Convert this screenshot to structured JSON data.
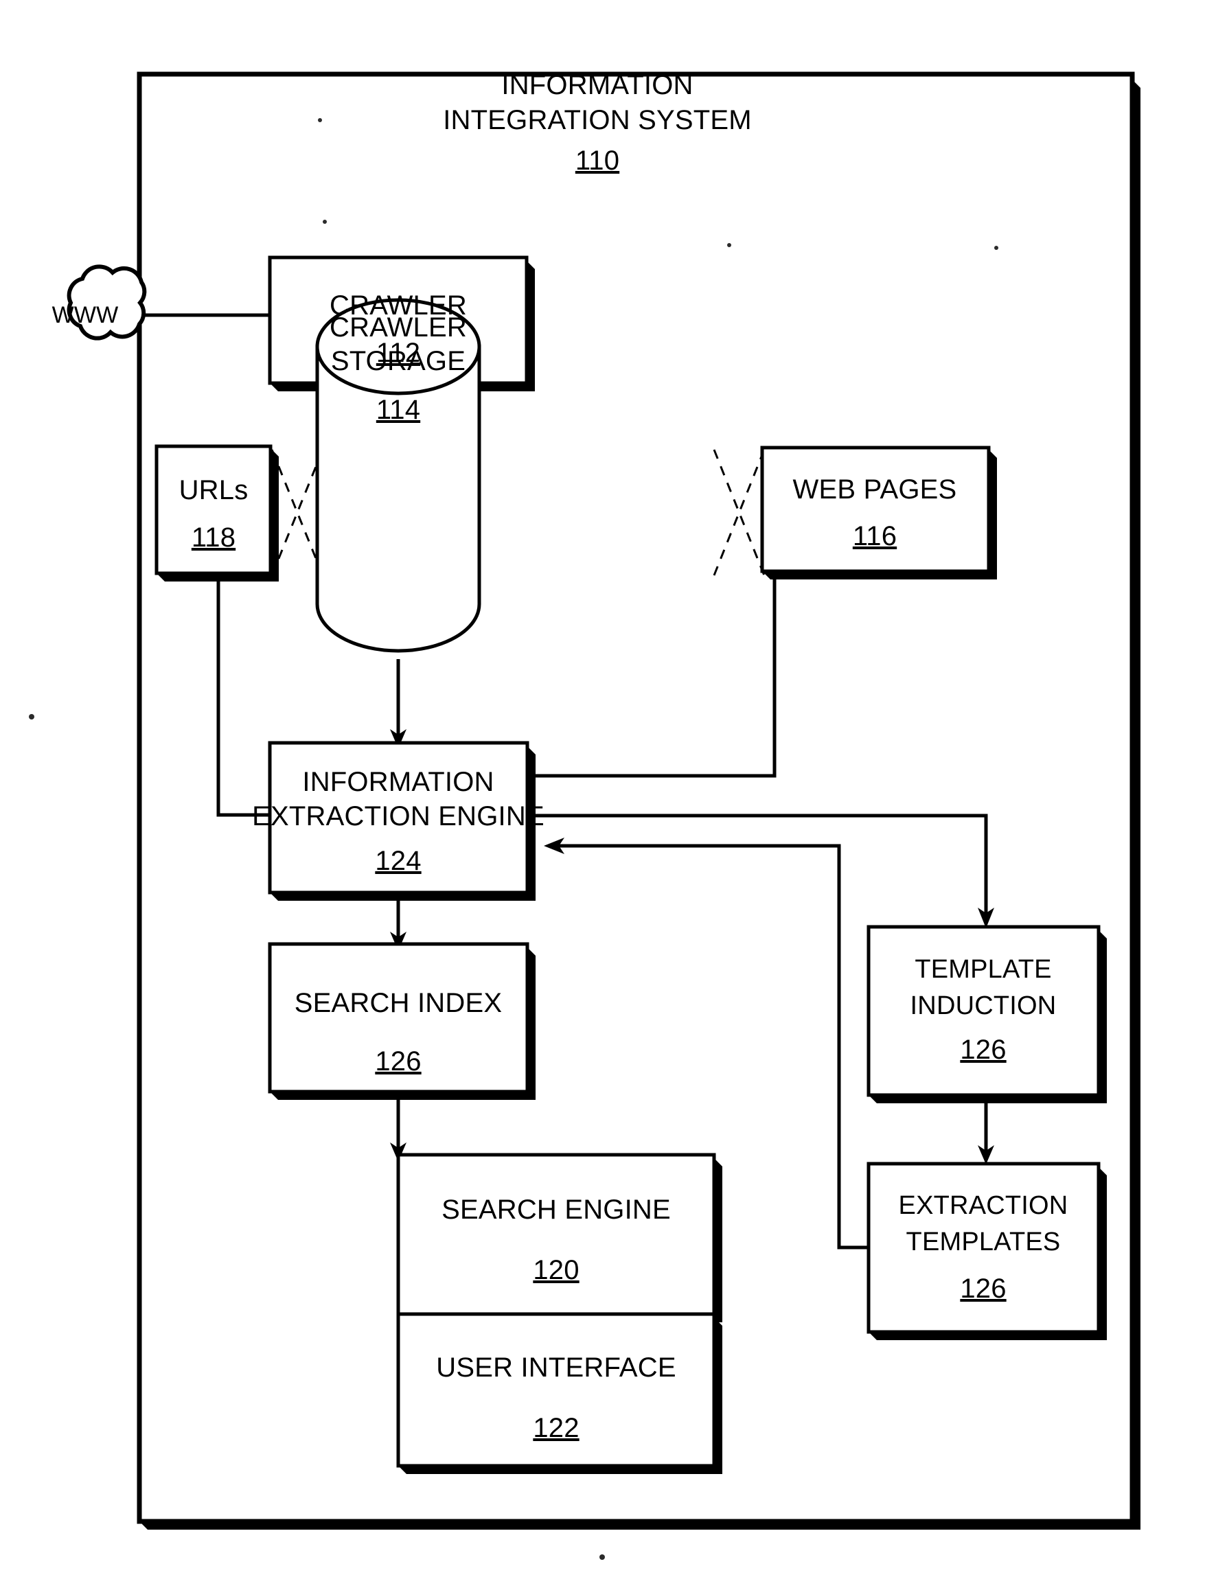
{
  "figure": {
    "type": "patent-block-diagram",
    "system_title_line1": "INFORMATION",
    "system_title_line2": "INTEGRATION SYSTEM",
    "system_ref": "110"
  },
  "nodes": {
    "www": {
      "label": "WWW",
      "shape": "cloud-icon"
    },
    "crawler": {
      "label": "CRAWLER",
      "ref": "112",
      "shape": "box"
    },
    "urls": {
      "label": "URLs",
      "ref": "118",
      "shape": "box"
    },
    "crawler_storage": {
      "line1": "CRAWLER",
      "line2": "STORAGE",
      "ref": "114",
      "shape": "cylinder"
    },
    "web_pages": {
      "label": "WEB PAGES",
      "ref": "116",
      "shape": "box"
    },
    "extraction_engine": {
      "line1": "INFORMATION",
      "line2": "EXTRACTION ENGINE",
      "ref": "124",
      "shape": "box"
    },
    "search_index": {
      "label": "SEARCH INDEX",
      "ref": "126",
      "shape": "box"
    },
    "template_induction": {
      "line1": "TEMPLATE",
      "line2": "INDUCTION",
      "ref": "126",
      "shape": "box"
    },
    "search_engine": {
      "label": "SEARCH ENGINE",
      "ref": "120",
      "shape": "box"
    },
    "user_interface": {
      "label": "USER INTERFACE",
      "ref": "122",
      "shape": "box"
    },
    "extraction_templates": {
      "line1": "EXTRACTION",
      "line2": "TEMPLATES",
      "ref": "126",
      "shape": "box"
    }
  },
  "colors": {
    "ink": "#000000",
    "paper": "#ffffff"
  }
}
